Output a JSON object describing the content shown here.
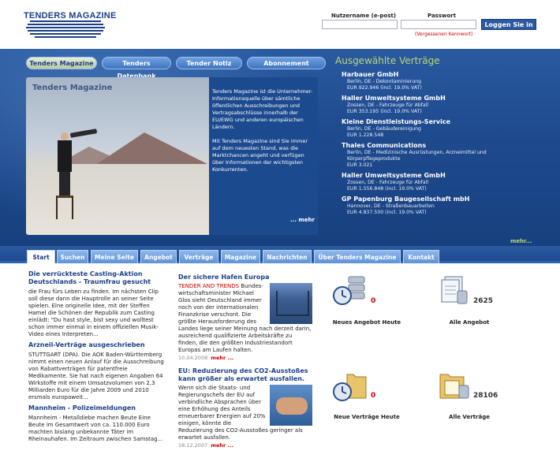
{
  "header": {
    "logo_text": "TENDERS MAGAZINE",
    "login": {
      "username_label": "Nutzername (e-post)",
      "password_label": "Passwort",
      "forgot_label": "(Vergessenen Kennwort)",
      "login_button": "Loggen Sie in",
      "username_value": "",
      "password_value": ""
    }
  },
  "hero": {
    "pill_tabs": [
      "Tenders Magazine",
      "Tenders Datenbank",
      "Tender Notiz",
      "Abonnement"
    ],
    "panel_title": "Tenders Magazine",
    "panel_text_1": "Tenders Magazine ist die Unternehmer-Informationsquelle über sämtliche öffentlichen Ausschreibungen und Vertragsabschlüsse innerhalb der EU/EWG und anderen europäischen Ländern.",
    "panel_text_2": "Mit Tenders Magazine sind Sie immer auf dem neuesten Stand, was die Marktchancen angeht und verfügen über Informationen der wichtigsten Konkurrenten.",
    "panel_more": "... mehr"
  },
  "contracts": {
    "title": "Ausgewählte Verträge",
    "items": [
      {
        "name": "Harbauer GmbH",
        "line1": "Berlin, DE - Dekontaminierung",
        "line2": "EUR 922.946 (incl. 19.0% VAT)",
        "line3": ""
      },
      {
        "name": "Haller Umweltsysteme GmbH",
        "line1": "Zossen, DE - Fahrzeuge für Abfall",
        "line2": "EUR 353.195 (incl. 19.0% VAT)",
        "line3": ""
      },
      {
        "name": "Kleine Dienstleistungs-Service",
        "line1": "Berlin, DE - Gebäudereinigung",
        "line2": "EUR 1.228.548",
        "line3": ""
      },
      {
        "name": "Thales Communications",
        "line1": "Berlin, DE - Medizinische Ausrüstungen, Arzneimittel und",
        "line2": "Körperpflegeprodukte",
        "line3": "EUR 3.021"
      },
      {
        "name": "Haller Umweltsysteme GmbH",
        "line1": "Zossen, DE - Fahrzeuge für Abfall",
        "line2": "EUR 1.556.848 (incl. 19.0% VAT)",
        "line3": ""
      },
      {
        "name": "GP Papenburg Baugesellschaft mbH",
        "line1": "Hannover, DE - Straßenbauarbeiten",
        "line2": "EUR 4.837.500 (incl. 19.0% VAT)",
        "line3": ""
      }
    ],
    "more": "mehr..."
  },
  "nav": {
    "tabs": [
      "Start",
      "Suchen",
      "Meine Seite",
      "Angebot",
      "Verträge",
      "Magazine",
      "Nachrichten",
      "Über Tenders Magazine",
      "Kontakt"
    ]
  },
  "news_left": [
    {
      "title": "Die verrückteste Casting-Aktion Deutschlands - Traumfrau gesucht",
      "text": "die Frau fürs Leben zu finden. Im nächsten Clip soll diese dann die Hauptrolle an seiner Seite spielen. Eine originelle Idee, mit der Steffen Hamel die Schönen der Republik zum Casting einlädt: \"Du hast style, bist sexy und wolltest schon immer einmal in einem offiziellen Musik-Video eines Interpreten..."
    },
    {
      "title": "Arzneil-Verträge ausgeschrieben",
      "text": "STUTTGART (DPA). Die AOK Baden-Württemberg nimmt einen neuen Anlauf für die Ausschreibung von Rabattverträgen für patentfreie Medikamente. Sie hat nach eigenen Angaben 64 Wirkstoffe mit einem Umsatzvolumen von 2,3 Milliarden Euro für die Jahre 2009 und 2010 ersmals europaweit..."
    },
    {
      "title": "Mannheim - Polizeimeldungen",
      "text": "Mannheim - Metalldiebe machen Beute Eine Beute im Gesamtwert von ca. 110.000 Euro machten bislang unbekannte Täter im Rheinauhafen. Im Zeitraum zwischen Samstag..."
    }
  ],
  "articles": [
    {
      "title": "Der sichere Hafen Europa",
      "lead_red": "TENDER AND TRENDS",
      "text": " Bundes-wirtschaftsminister Michael Glos sieht Deutschland immer noch von der internationalen Finanzkrise verschont. Die größte Herausforderung des Landes liege seiner Meinung nach derzeit darin, ausreichend qualifizierte Arbeitskräfte zu finden, die den größten Industriestandort Europas am Laufen halten.",
      "date": "10.04.2008",
      "more": "mehr ..."
    },
    {
      "title": "EU: Reduzierung des CO2-Ausstoßes kann größer als erwartet ausfallen.",
      "lead_red": "",
      "text": "Wenn sich die Staats- und Regierungschefs der EU auf verbindliche Absprachen über eine Erhöhung des Anteils erneuerbarer Energien auf 20% einigen, könnte die Reduzierung des CO2-Ausstoßes geringer als erwartet ausfallen.",
      "date": "18.12.2007",
      "more": "mehr ..."
    }
  ],
  "stats": [
    {
      "label": "Neues Angebot Heute",
      "value": "0",
      "icon": "server-clock-icon",
      "red": true
    },
    {
      "label": "Alle Angebot",
      "value": "2625",
      "icon": "document-stack-icon",
      "red": false
    },
    {
      "label": "Neue Verträge Heute",
      "value": "0",
      "icon": "folder-clock-icon",
      "red": true
    },
    {
      "label": "Alle Verträge",
      "value": "28106",
      "icon": "folder-stack-icon",
      "red": false
    }
  ],
  "colors": {
    "brand_blue": "#1b3f86",
    "hero_blue": "#1f4b8f",
    "accent_green": "#b7d879",
    "red": "#cc0000"
  }
}
